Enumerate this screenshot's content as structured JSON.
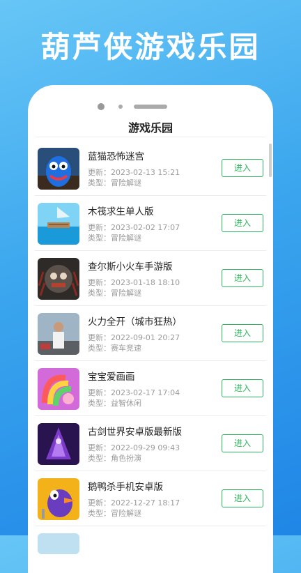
{
  "promo": {
    "title": "葫芦侠游戏乐园"
  },
  "screen": {
    "title": "游戏乐园"
  },
  "labels": {
    "update_prefix": "更新：",
    "type_prefix": "类型："
  },
  "games": [
    {
      "name": "蓝猫恐怖迷宫",
      "updated": "2023-02-13 15:21",
      "type": "冒险解谜",
      "button": "进入",
      "icon": "blue-monster-icon"
    },
    {
      "name": "木筏求生单人版",
      "updated": "2023-02-02 17:07",
      "type": "冒险解谜",
      "button": "进入",
      "icon": "raft-icon"
    },
    {
      "name": "查尔斯小火车手游版",
      "updated": "2023-01-18 18:10",
      "type": "冒险解谜",
      "button": "进入",
      "icon": "spider-train-icon"
    },
    {
      "name": "火力全开（城市狂热）",
      "updated": "2022-09-01 20:27",
      "type": "赛车竞速",
      "button": "进入",
      "icon": "city-man-icon"
    },
    {
      "name": "宝宝爱画画",
      "updated": "2023-02-17 17:04",
      "type": "益智休闲",
      "button": "进入",
      "icon": "rainbow-drawing-icon"
    },
    {
      "name": "古剑世界安卓版最新版",
      "updated": "2022-09-29 09:43",
      "type": "角色扮演",
      "button": "进入",
      "icon": "purple-warrior-icon"
    },
    {
      "name": "鹅鸭杀手机安卓版",
      "updated": "2022-12-27 18:17",
      "type": "冒险解谜",
      "button": "进入",
      "icon": "goose-icon"
    }
  ]
}
